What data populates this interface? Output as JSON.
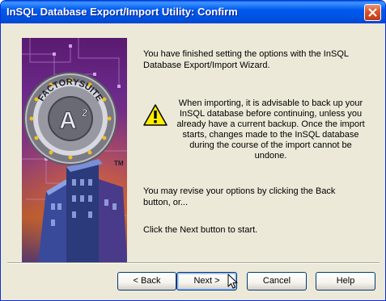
{
  "window": {
    "title": "InSQL Database Export/Import Utility: Confirm"
  },
  "content": {
    "intro": "You have finished setting the options with the InSQL Database Export/Import Wizard.",
    "warning": "When importing, it is advisable to back up your InSQL database before continuing, unless you already have a current backup. Once the import starts, changes made to the  InSQL database during the course of the import cannot be undone.",
    "revise": "You may revise your options by clicking the Back button, or...",
    "next_hint": "Click the Next button to start."
  },
  "logo": {
    "text": "FACTORYSUITE",
    "mark": "A",
    "sup": "2",
    "tm": "TM"
  },
  "buttons": {
    "back": "< Back",
    "next": "Next >",
    "cancel": "Cancel",
    "help": "Help"
  },
  "icons": {
    "close": "close-icon",
    "warning": "warning-icon",
    "cursor": "mouse-cursor-icon"
  },
  "colors": {
    "titlebar": "#0054e3",
    "close": "#d9542b",
    "face": "#ece9d8",
    "warning_yellow": "#ffee00"
  }
}
